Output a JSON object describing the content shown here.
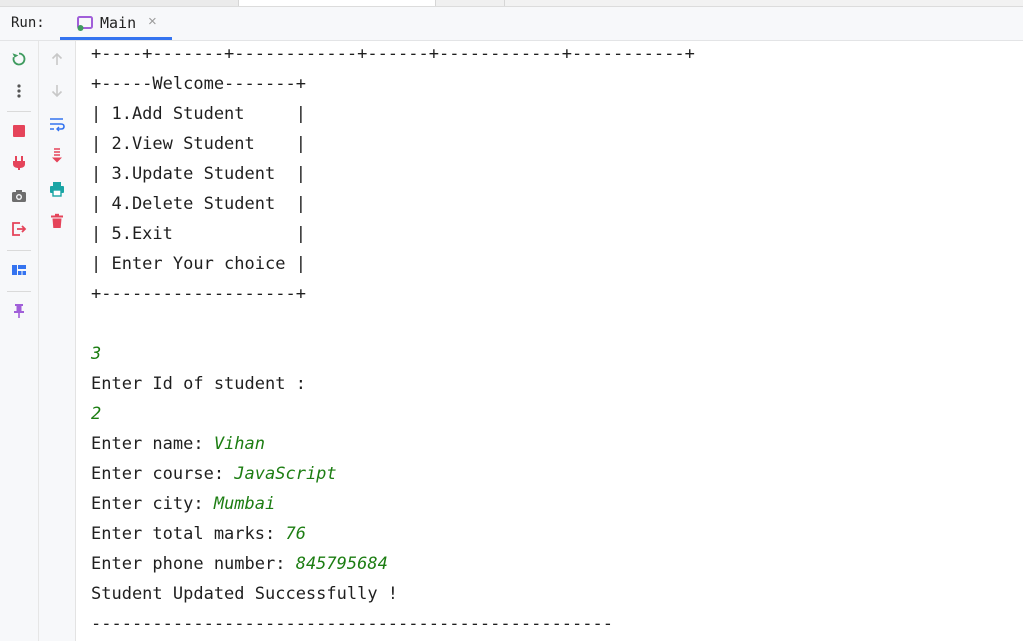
{
  "run_panel": {
    "label": "Run:",
    "tab": {
      "label": "Main",
      "close": "×"
    }
  },
  "toolbar": {
    "col1": [
      {
        "name": "rerun-icon",
        "color": "#3f9b5f"
      },
      {
        "name": "more-icon",
        "color": "#555555"
      },
      {
        "name": "stop-icon",
        "color": "#e5445a"
      },
      {
        "name": "plug-icon",
        "color": "#e5445a"
      },
      {
        "name": "camera-icon",
        "color": "#6e6e6e"
      },
      {
        "name": "exit-icon",
        "color": "#e5445a"
      },
      {
        "name": "layout-icon",
        "color": "#3574f0"
      },
      {
        "name": "pin-icon",
        "color": "#a15fd9"
      }
    ],
    "col2": [
      {
        "name": "arrow-up-icon",
        "color": "#c8c8c8"
      },
      {
        "name": "arrow-down-icon",
        "color": "#c8c8c8"
      },
      {
        "name": "soft-wrap-icon",
        "color": "#3574f0"
      },
      {
        "name": "scroll-to-end-icon",
        "color": "#e5445a"
      },
      {
        "name": "print-icon",
        "color": "#1aa5a5"
      },
      {
        "name": "trash-icon",
        "color": "#e5445a"
      }
    ]
  },
  "console": {
    "lines": [
      {
        "prompt": "+----+-------+------------+------+------------+-----------+",
        "input": ""
      },
      {
        "prompt": "+-----Welcome-------+",
        "input": ""
      },
      {
        "prompt": "| 1.Add Student     |",
        "input": ""
      },
      {
        "prompt": "| 2.View Student    |",
        "input": ""
      },
      {
        "prompt": "| 3.Update Student  |",
        "input": ""
      },
      {
        "prompt": "| 4.Delete Student  |",
        "input": ""
      },
      {
        "prompt": "| 5.Exit            |",
        "input": ""
      },
      {
        "prompt": "| Enter Your choice |",
        "input": ""
      },
      {
        "prompt": "+-------------------+",
        "input": ""
      },
      {
        "prompt": "",
        "input": ""
      },
      {
        "prompt": "",
        "input": "3"
      },
      {
        "prompt": "Enter Id of student :",
        "input": ""
      },
      {
        "prompt": "",
        "input": "2"
      },
      {
        "prompt": "Enter name: ",
        "input": "Vihan"
      },
      {
        "prompt": "Enter course: ",
        "input": "JavaScript"
      },
      {
        "prompt": "Enter city: ",
        "input": "Mumbai"
      },
      {
        "prompt": "Enter total marks: ",
        "input": "76"
      },
      {
        "prompt": "Enter phone number: ",
        "input": "845795684"
      },
      {
        "prompt": "Student Updated Successfully !",
        "input": ""
      },
      {
        "prompt": "---------------------------------------------------",
        "input": ""
      }
    ]
  }
}
